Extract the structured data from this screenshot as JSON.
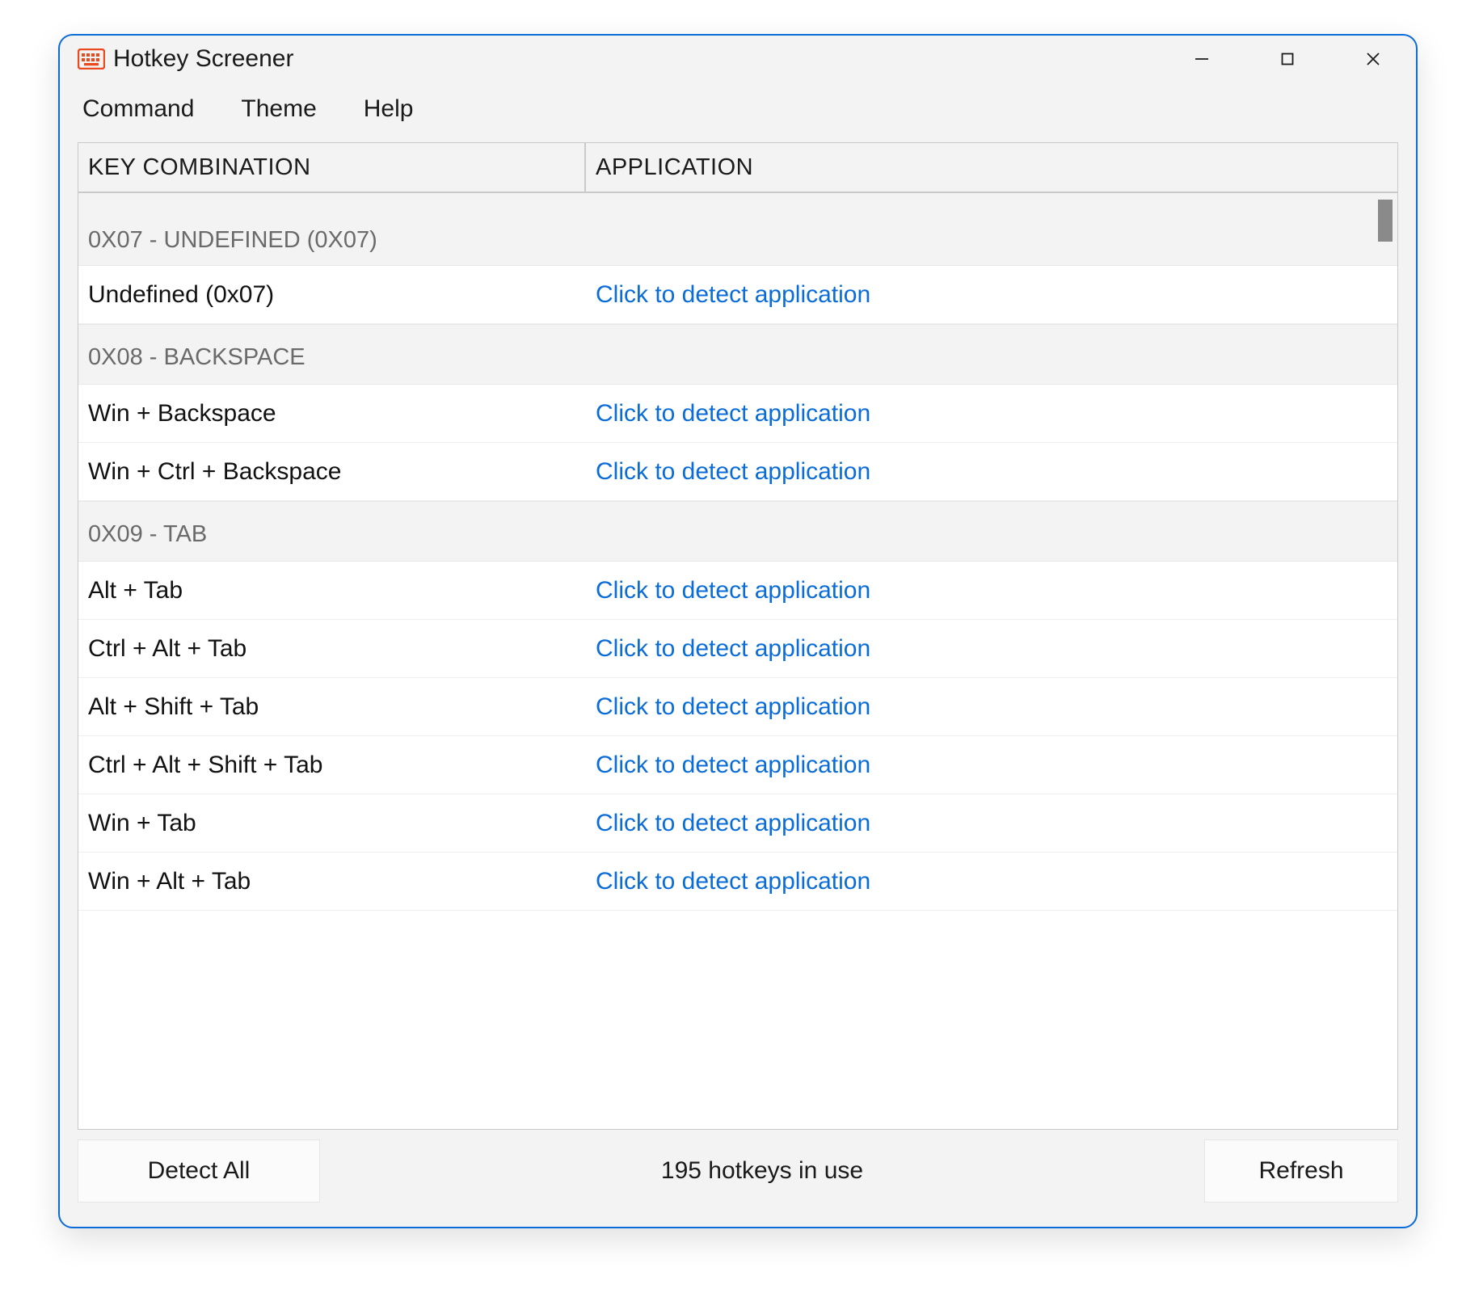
{
  "window": {
    "title": "Hotkey Screener"
  },
  "menubar": {
    "items": [
      "Command",
      "Theme",
      "Help"
    ]
  },
  "table": {
    "columns": {
      "key": "KEY COMBINATION",
      "app": "APPLICATION"
    },
    "detect_label": "Click to detect application",
    "groups": [
      {
        "header": "0X07 - UNDEFINED (0X07)",
        "rows": [
          {
            "key": "Undefined (0x07)"
          }
        ]
      },
      {
        "header": "0X08 - BACKSPACE",
        "rows": [
          {
            "key": "Win + Backspace"
          },
          {
            "key": "Win + Ctrl + Backspace"
          }
        ]
      },
      {
        "header": "0X09 - TAB",
        "rows": [
          {
            "key": "Alt + Tab"
          },
          {
            "key": "Ctrl + Alt + Tab"
          },
          {
            "key": "Alt + Shift + Tab"
          },
          {
            "key": "Ctrl + Alt + Shift + Tab"
          },
          {
            "key": "Win + Tab"
          },
          {
            "key": "Win + Alt + Tab"
          }
        ]
      }
    ]
  },
  "footer": {
    "detect_all": "Detect All",
    "status": "195 hotkeys in use",
    "refresh": "Refresh"
  }
}
